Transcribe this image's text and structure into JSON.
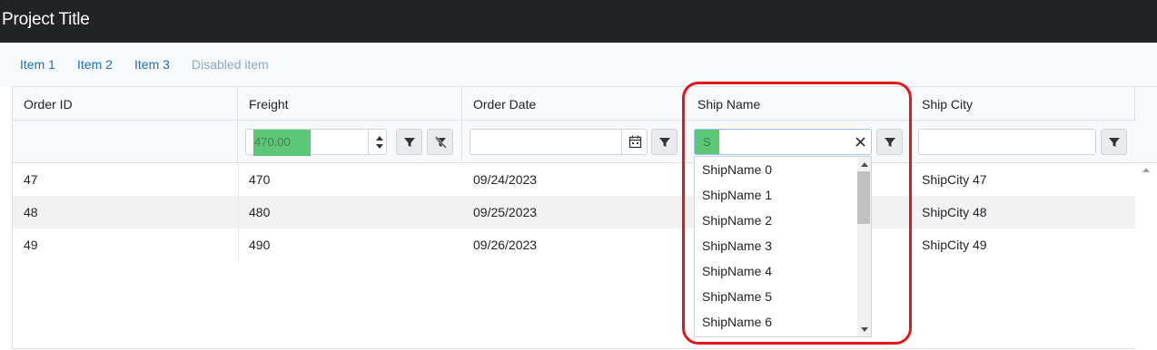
{
  "app": {
    "title": "Project Title"
  },
  "nav": {
    "items": [
      "Item 1",
      "Item 2",
      "Item 3"
    ],
    "disabled_item": "Disabled item"
  },
  "grid": {
    "columns": [
      "Order ID",
      "Freight",
      "Order Date",
      "Ship Name",
      "Ship City"
    ],
    "filters": {
      "freight_value": "470.00",
      "order_date_value": "",
      "ship_name_value": "S",
      "ship_city_value": ""
    },
    "rows": [
      {
        "order_id": "47",
        "freight": "470",
        "order_date": "09/24/2023",
        "ship_name": "",
        "ship_city": "ShipCity 47"
      },
      {
        "order_id": "48",
        "freight": "480",
        "order_date": "09/25/2023",
        "ship_name": "",
        "ship_city": "ShipCity 48"
      },
      {
        "order_id": "49",
        "freight": "490",
        "order_date": "09/26/2023",
        "ship_name": "",
        "ship_city": "ShipCity 49"
      }
    ]
  },
  "autocomplete": {
    "options": [
      "ShipName 0",
      "ShipName 1",
      "ShipName 2",
      "ShipName 3",
      "ShipName 4",
      "ShipName 5",
      "ShipName 6"
    ]
  },
  "colors": {
    "highlight": "#5cc777",
    "annotation": "#e3171c",
    "link": "#1a6fc3",
    "topbar": "#212327"
  },
  "icons": {
    "filter": "filter-icon",
    "clear_filter": "filter-clear-icon",
    "calendar": "calendar-icon",
    "clear": "close-icon"
  }
}
